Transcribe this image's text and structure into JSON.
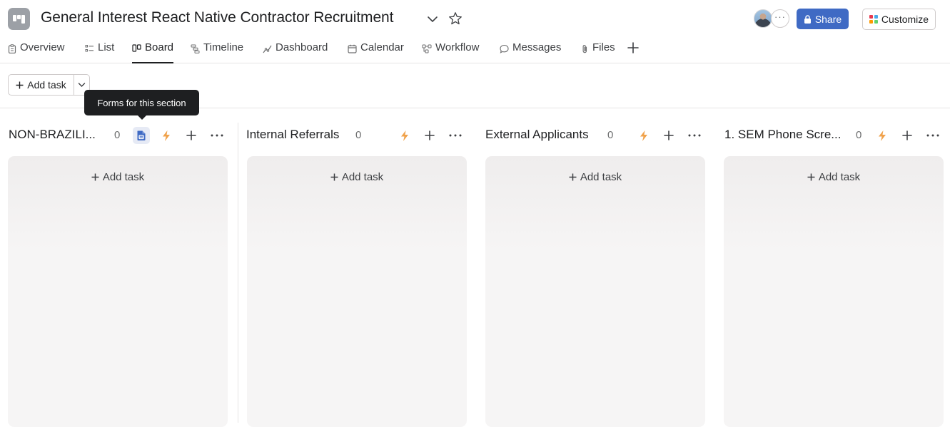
{
  "header": {
    "project_title": "General Interest React Native Contractor Recruitment",
    "share_label": "Share",
    "customize_label": "Customize",
    "avatar_more_label": "···"
  },
  "tabs": [
    {
      "label": "Overview",
      "icon": "clipboard-icon"
    },
    {
      "label": "List",
      "icon": "list-icon"
    },
    {
      "label": "Board",
      "icon": "board-icon",
      "active": true
    },
    {
      "label": "Timeline",
      "icon": "timeline-icon"
    },
    {
      "label": "Dashboard",
      "icon": "dashboard-icon"
    },
    {
      "label": "Calendar",
      "icon": "calendar-icon"
    },
    {
      "label": "Workflow",
      "icon": "workflow-icon"
    },
    {
      "label": "Messages",
      "icon": "message-icon"
    },
    {
      "label": "Files",
      "icon": "paperclip-icon"
    }
  ],
  "toolbar": {
    "add_task_label": "Add task"
  },
  "tooltip": {
    "text": "Forms for this section"
  },
  "columns": [
    {
      "title": "NON-BRAZILI...",
      "count": "0",
      "add_task_label": "Add task"
    },
    {
      "title": "Internal Referrals",
      "count": "0",
      "add_task_label": "Add task"
    },
    {
      "title": "External Applicants",
      "count": "0",
      "add_task_label": "Add task"
    },
    {
      "title": "1. SEM Phone Scre...",
      "count": "0",
      "add_task_label": "Add task"
    }
  ],
  "colors": {
    "accent_blue": "#3f6ac4",
    "lightning_orange": "#f0a24b",
    "text_primary": "#1e1f21"
  }
}
